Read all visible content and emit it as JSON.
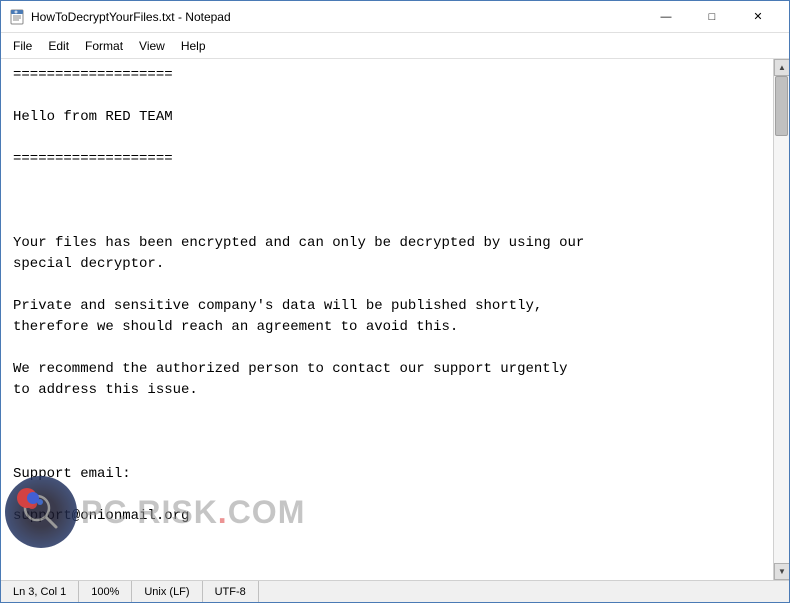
{
  "window": {
    "title": "HowToDecryptYourFiles.txt - Notepad",
    "icon": "notepad-icon"
  },
  "titlebar": {
    "minimize_label": "—",
    "maximize_label": "□",
    "close_label": "✕"
  },
  "menu": {
    "items": [
      {
        "label": "File",
        "id": "menu-file"
      },
      {
        "label": "Edit",
        "id": "menu-edit"
      },
      {
        "label": "Format",
        "id": "menu-format"
      },
      {
        "label": "View",
        "id": "menu-view"
      },
      {
        "label": "Help",
        "id": "menu-help"
      }
    ]
  },
  "content": {
    "text": "===================\n\nHello from RED TEAM\n\n===================\n\n\n\nYour files has been encrypted and can only be decrypted by using our\nspecial decryptor.\n\nPrivate and sensitive company's data will be published shortly,\ntherefore we should reach an agreement to avoid this.\n\nWe recommend the authorized person to contact our support urgently\nto address this issue.\n\n\n\nSupport email:\n\nsupport@onionmail.org"
  },
  "statusbar": {
    "line_col": "Ln 3, Col 1",
    "zoom": "100%",
    "line_ending": "Unix (LF)",
    "encoding": "UTF-8"
  },
  "watermark": {
    "text": "PC RISK",
    "dot": ".",
    "suffix": "COM"
  }
}
